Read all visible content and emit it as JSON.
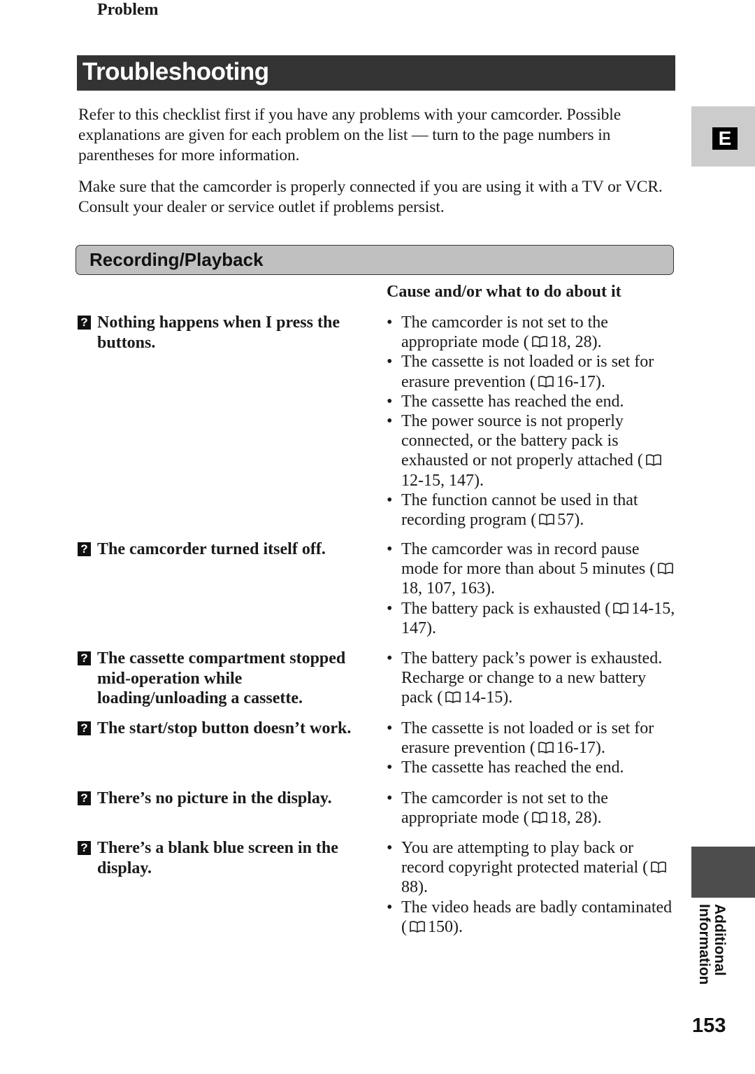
{
  "header": {
    "title": "Troubleshooting"
  },
  "intro": {
    "paragraph1": "Refer to this checklist first if you have any problems with your camcorder. Possible explanations are given for each problem on the list — turn to the page numbers in parentheses for more information.",
    "paragraph2": "Make sure that the camcorder is properly connected if you are using it with a TV or VCR. Consult your dealer or service outlet if problems persist."
  },
  "language_tab": {
    "letter": "E"
  },
  "section": {
    "title": "Recording/Playback"
  },
  "columns": {
    "problem": "Problem",
    "cause": "Cause and/or what to do about it"
  },
  "icons": {
    "problem_marker": "question-mark-icon",
    "page_reference": "book-icon",
    "question_glyph": "?",
    "bullet": "•"
  },
  "rows": [
    {
      "problem": "Nothing happens when I press the buttons.",
      "causes": [
        {
          "text": "The camcorder is not set to the appropriate mode (",
          "pages": "18, 28)."
        },
        {
          "text": "The cassette is not loaded or is set for erasure prevention (",
          "pages": "16-17)."
        },
        {
          "text": "The cassette has reached the end.",
          "pages": null
        },
        {
          "text": "The power source is not properly connected, or the battery pack is exhausted or not properly attached (",
          "pages": "12-15, 147)."
        },
        {
          "text": "The function cannot be used in that recording program (",
          "pages": "57)."
        }
      ]
    },
    {
      "problem": "The camcorder turned itself off.",
      "causes": [
        {
          "text": "The camcorder was in record pause mode for more than about 5 minutes (",
          "pages": "18, 107, 163)."
        },
        {
          "text": "The battery pack is exhausted (",
          "pages": "14-15, 147)."
        }
      ]
    },
    {
      "problem": "The cassette compartment stopped mid-operation while loading/unloading a cassette.",
      "causes": [
        {
          "text": "The battery pack’s power is exhausted. Recharge or change to a new battery pack (",
          "pages": "14-15)."
        }
      ]
    },
    {
      "problem": "The start/stop button doesn’t work.",
      "causes": [
        {
          "text": "The cassette is not loaded or is set for erasure prevention (",
          "pages": "16-17)."
        },
        {
          "text": "The cassette has reached the end.",
          "pages": null
        }
      ]
    },
    {
      "problem": "There’s no picture in the display.",
      "causes": [
        {
          "text": "The camcorder is not set to the appropriate mode (",
          "pages": "18, 28)."
        }
      ]
    },
    {
      "problem": "There’s a blank blue screen in the display.",
      "causes": [
        {
          "text": "You are attempting to play back or record copyright protected material (",
          "pages": "88)."
        },
        {
          "text": "The video heads are badly contaminated (",
          "pages": "150)."
        }
      ]
    }
  ],
  "side": {
    "section_label": "Additional Information",
    "label_line1": "Additional",
    "label_line2": "Information"
  },
  "footer": {
    "page_number": "153"
  }
}
